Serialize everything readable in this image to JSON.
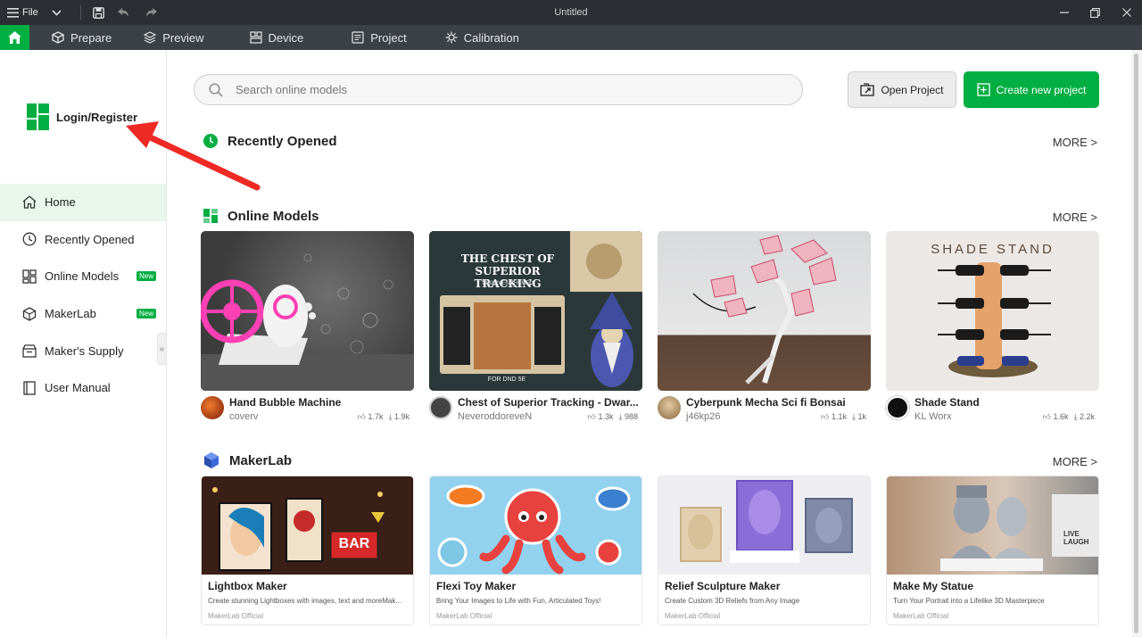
{
  "titlebar": {
    "file_label": "File",
    "title": "Untitled"
  },
  "nav": {
    "tabs": [
      {
        "label": "Prepare",
        "icon": "cube-icon"
      },
      {
        "label": "Preview",
        "icon": "layers-icon"
      },
      {
        "label": "Device",
        "icon": "device-icon"
      },
      {
        "label": "Project",
        "icon": "project-icon"
      },
      {
        "label": "Calibration",
        "icon": "calibration-icon"
      }
    ]
  },
  "sidebar": {
    "login_label": "Login/Register",
    "items": [
      {
        "label": "Home",
        "icon": "home-icon",
        "active": true
      },
      {
        "label": "Recently Opened",
        "icon": "clock-icon"
      },
      {
        "label": "Online Models",
        "icon": "models-icon",
        "badge": "New"
      },
      {
        "label": "MakerLab",
        "icon": "makerlab-icon",
        "badge": "New"
      },
      {
        "label": "Maker's Supply",
        "icon": "supply-icon"
      },
      {
        "label": "User Manual",
        "icon": "book-icon"
      }
    ]
  },
  "main": {
    "search_placeholder": "Search online models",
    "open_project_label": "Open Project",
    "create_project_label": "Create new project",
    "recent": {
      "title": "Recently Opened",
      "more": "MORE >"
    },
    "online": {
      "title": "Online Models",
      "more": "MORE >",
      "cards": [
        {
          "title": "Hand Bubble Machine",
          "author": "coverv",
          "likes": "1.7k",
          "downloads": "1.9k"
        },
        {
          "title": "Chest of Superior Tracking - Dwar...",
          "author": "NeveroddoreveN",
          "likes": "1.3k",
          "downloads": "988",
          "image_text_1": "THE CHEST OF",
          "image_text_2": "SUPERIOR TRACKING",
          "image_text_3": "DWARVEN THEMED",
          "image_text_4": "FOR DND 5E"
        },
        {
          "title": "Cyberpunk Mecha Sci fi Bonsai",
          "author": "j46kp26",
          "likes": "1.1k",
          "downloads": "1k"
        },
        {
          "title": "Shade Stand",
          "author": "KL Worx",
          "likes": "1.6k",
          "downloads": "2.2k",
          "image_text_1": "SHADE STAND"
        }
      ]
    },
    "makerlab": {
      "title": "MakerLab",
      "more": "MORE >",
      "cards": [
        {
          "title": "Lightbox Maker",
          "desc": "Create stunning Lightboxes with images, text and moreMak...",
          "by": "MakerLab Official",
          "image_text_1": "BAR"
        },
        {
          "title": "Flexi Toy Maker",
          "desc": "Bring Your Images to Life with Fun, Articulated Toys!",
          "by": "MakerLab Official"
        },
        {
          "title": "Relief Sculpture Maker",
          "desc": "Create Custom 3D Reliefs from Any Image",
          "by": "MakerLab Official"
        },
        {
          "title": "Make My Statue",
          "desc": "Turn Your Portrait into a Lifelike 3D Masterpiece",
          "by": "MakerLab Official",
          "image_text_1": "LIVE LAUGH"
        }
      ]
    }
  },
  "colors": {
    "accent": "#00ae42",
    "titlebar": "#2b2f33",
    "navbar": "#3b4146",
    "annotation_arrow": "#ee2a24"
  }
}
